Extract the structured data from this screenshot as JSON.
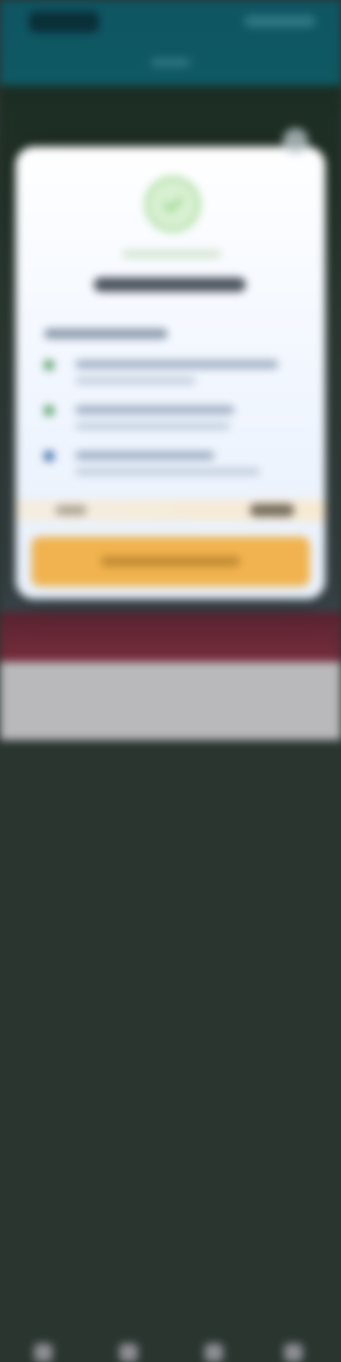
{
  "status_bar": {
    "time": "",
    "indicators": ""
  },
  "header": {
    "title": ""
  },
  "modal": {
    "close_icon": "close-icon",
    "badge_icon": "check-circle-icon",
    "subtitle": "",
    "title": "",
    "section_label": "",
    "features": [
      {
        "icon": "check-icon",
        "icon_color": "#5aa06a",
        "text": "",
        "subtext": ""
      },
      {
        "icon": "check-icon",
        "icon_color": "#5aa06a",
        "text": "",
        "subtext": ""
      },
      {
        "icon": "info-icon",
        "icon_color": "#3b6ea5",
        "text": "",
        "subtext": ""
      }
    ],
    "price_label": "",
    "price_value": "",
    "cta_label": ""
  },
  "colors": {
    "header_bg": "#0f5563",
    "cta_bg": "#f0b34f",
    "badge_green": "#98d58b",
    "band_maroon": "#6e2a38",
    "nav_bg": "#b9b9bb"
  },
  "bottom_nav": {
    "items": [
      "",
      "",
      "",
      ""
    ]
  }
}
